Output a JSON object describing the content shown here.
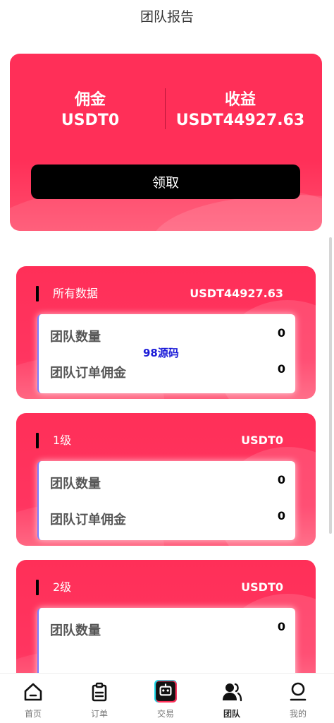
{
  "header": {
    "title": "团队报告"
  },
  "summary": {
    "commission_label": "佣金",
    "commission_value": "USDT0",
    "earnings_label": "收益",
    "earnings_value": "USDT44927.63",
    "claim_label": "领取"
  },
  "watermark": "98源码",
  "sections": [
    {
      "name": "所有数据",
      "amount": "USDT44927.63",
      "team_count_label": "团队数量",
      "team_count": "0",
      "team_commission_label": "团队订单佣金",
      "team_commission": "0"
    },
    {
      "name": "1级",
      "amount": "USDT0",
      "team_count_label": "团队数量",
      "team_count": "0",
      "team_commission_label": "团队订单佣金",
      "team_commission": "0"
    },
    {
      "name": "2级",
      "amount": "USDT0",
      "team_count_label": "团队数量",
      "team_count": "0"
    }
  ],
  "tabbar": {
    "items": [
      {
        "label": "首页",
        "icon": "home-icon"
      },
      {
        "label": "订单",
        "icon": "clipboard-icon"
      },
      {
        "label": "交易",
        "icon": "robot-icon"
      },
      {
        "label": "团队",
        "icon": "team-icon"
      },
      {
        "label": "我的",
        "icon": "profile-icon"
      }
    ],
    "active_index": 3
  },
  "colors": {
    "accent": "#ff2f58",
    "button": "#000000",
    "watermark": "#1b1bd8"
  }
}
